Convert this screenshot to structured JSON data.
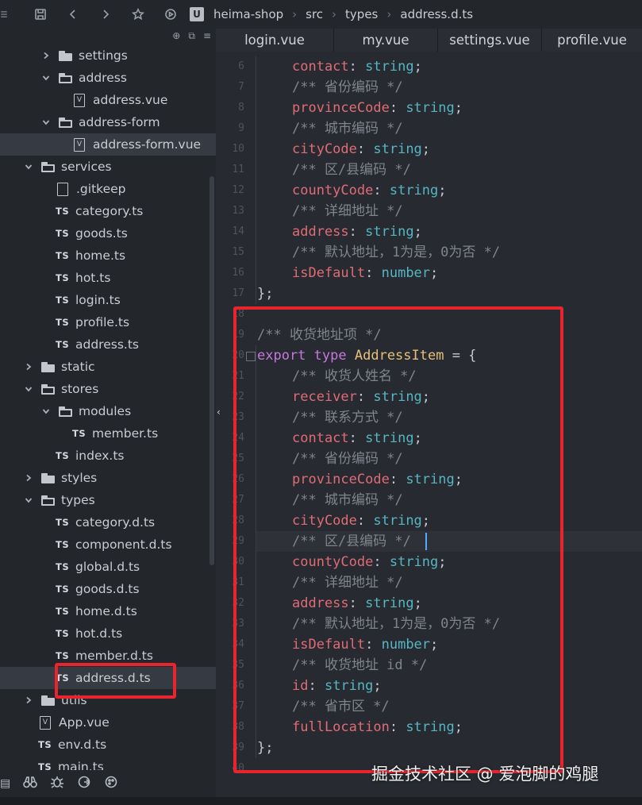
{
  "breadcrumb": [
    "heima-shop",
    "src",
    "types",
    "address.d.ts"
  ],
  "toolbar_icons": [
    "save-icon",
    "back-icon",
    "forward-icon",
    "star-icon",
    "run-icon"
  ],
  "tabs": [
    "login.vue",
    "my.vue",
    "settings.vue",
    "profile.vue"
  ],
  "tree": [
    {
      "label": "settings",
      "kind": "folder",
      "open": false,
      "depth": 2
    },
    {
      "label": "address",
      "kind": "folder",
      "open": true,
      "depth": 2
    },
    {
      "label": "address.vue",
      "kind": "vue",
      "depth": 3
    },
    {
      "label": "address-form",
      "kind": "folder",
      "open": true,
      "depth": 2
    },
    {
      "label": "address-form.vue",
      "kind": "vue",
      "depth": 3,
      "selected": true
    },
    {
      "label": "services",
      "kind": "folder",
      "open": true,
      "depth": 1
    },
    {
      "label": ".gitkeep",
      "kind": "file",
      "depth": 2
    },
    {
      "label": "category.ts",
      "kind": "ts",
      "depth": 2
    },
    {
      "label": "goods.ts",
      "kind": "ts",
      "depth": 2
    },
    {
      "label": "home.ts",
      "kind": "ts",
      "depth": 2
    },
    {
      "label": "hot.ts",
      "kind": "ts",
      "depth": 2
    },
    {
      "label": "login.ts",
      "kind": "ts",
      "depth": 2
    },
    {
      "label": "profile.ts",
      "kind": "ts",
      "depth": 2
    },
    {
      "label": "address.ts",
      "kind": "ts",
      "depth": 2
    },
    {
      "label": "static",
      "kind": "folder",
      "open": false,
      "depth": 1
    },
    {
      "label": "stores",
      "kind": "folder",
      "open": true,
      "depth": 1
    },
    {
      "label": "modules",
      "kind": "folder",
      "open": true,
      "depth": 2
    },
    {
      "label": "member.ts",
      "kind": "ts",
      "depth": 3
    },
    {
      "label": "index.ts",
      "kind": "ts",
      "depth": 2
    },
    {
      "label": "styles",
      "kind": "folder",
      "open": false,
      "depth": 1
    },
    {
      "label": "types",
      "kind": "folder",
      "open": true,
      "depth": 1
    },
    {
      "label": "category.d.ts",
      "kind": "ts",
      "depth": 2
    },
    {
      "label": "component.d.ts",
      "kind": "ts",
      "depth": 2
    },
    {
      "label": "global.d.ts",
      "kind": "ts",
      "depth": 2
    },
    {
      "label": "goods.d.ts",
      "kind": "ts",
      "depth": 2
    },
    {
      "label": "home.d.ts",
      "kind": "ts",
      "depth": 2
    },
    {
      "label": "hot.d.ts",
      "kind": "ts",
      "depth": 2
    },
    {
      "label": "member.d.ts",
      "kind": "ts",
      "depth": 2
    },
    {
      "label": "address.d.ts",
      "kind": "ts",
      "depth": 2,
      "selected": true
    },
    {
      "label": "utils",
      "kind": "folder",
      "open": false,
      "depth": 1
    },
    {
      "label": "App.vue",
      "kind": "vue",
      "depth": 1
    },
    {
      "label": "env.d.ts",
      "kind": "ts",
      "depth": 1
    },
    {
      "label": "main.ts",
      "kind": "ts",
      "depth": 1
    }
  ],
  "code": [
    {
      "n": "6",
      "tokens": [
        [
          "prop",
          "contact"
        ],
        [
          "punc",
          ": "
        ],
        [
          "type",
          "string"
        ],
        [
          "punc",
          ";"
        ]
      ],
      "indent": 2
    },
    {
      "n": "7",
      "tokens": [
        [
          "comment",
          "/** 省份编码 */"
        ]
      ],
      "indent": 2
    },
    {
      "n": "8",
      "tokens": [
        [
          "prop",
          "provinceCode"
        ],
        [
          "punc",
          ": "
        ],
        [
          "type",
          "string"
        ],
        [
          "punc",
          ";"
        ]
      ],
      "indent": 2
    },
    {
      "n": "9",
      "tokens": [
        [
          "comment",
          "/** 城市编码 */"
        ]
      ],
      "indent": 2
    },
    {
      "n": "10",
      "tokens": [
        [
          "prop",
          "cityCode"
        ],
        [
          "punc",
          ": "
        ],
        [
          "type",
          "string"
        ],
        [
          "punc",
          ";"
        ]
      ],
      "indent": 2
    },
    {
      "n": "11",
      "tokens": [
        [
          "comment",
          "/** 区/县编码 */"
        ]
      ],
      "indent": 2
    },
    {
      "n": "12",
      "tokens": [
        [
          "prop",
          "countyCode"
        ],
        [
          "punc",
          ": "
        ],
        [
          "type",
          "string"
        ],
        [
          "punc",
          ";"
        ]
      ],
      "indent": 2
    },
    {
      "n": "13",
      "tokens": [
        [
          "comment",
          "/** 详细地址 */"
        ]
      ],
      "indent": 2
    },
    {
      "n": "14",
      "tokens": [
        [
          "prop",
          "address"
        ],
        [
          "punc",
          ": "
        ],
        [
          "type",
          "string"
        ],
        [
          "punc",
          ";"
        ]
      ],
      "indent": 2
    },
    {
      "n": "15",
      "tokens": [
        [
          "comment",
          "/** 默认地址，1为是，0为否 */"
        ]
      ],
      "indent": 2
    },
    {
      "n": "16",
      "tokens": [
        [
          "prop",
          "isDefault"
        ],
        [
          "punc",
          ": "
        ],
        [
          "type",
          "number"
        ],
        [
          "punc",
          ";"
        ]
      ],
      "indent": 2
    },
    {
      "n": "17",
      "tokens": [
        [
          "punc",
          "};"
        ]
      ],
      "indent": 0
    },
    {
      "n": "18",
      "tokens": [],
      "indent": 0
    },
    {
      "n": "19",
      "tokens": [
        [
          "comment",
          "/** 收货地址项 */"
        ]
      ],
      "indent": 0
    },
    {
      "n": "20",
      "tokens": [
        [
          "kw",
          "export"
        ],
        [
          "punc",
          " "
        ],
        [
          "kw",
          "type"
        ],
        [
          "punc",
          " "
        ],
        [
          "name",
          "AddressItem"
        ],
        [
          "punc",
          " = {"
        ]
      ],
      "indent": 0
    },
    {
      "n": "21",
      "tokens": [
        [
          "comment",
          "/** 收货人姓名 */"
        ]
      ],
      "indent": 2
    },
    {
      "n": "22",
      "tokens": [
        [
          "prop",
          "receiver"
        ],
        [
          "punc",
          ": "
        ],
        [
          "type",
          "string"
        ],
        [
          "punc",
          ";"
        ]
      ],
      "indent": 2
    },
    {
      "n": "23",
      "tokens": [
        [
          "comment",
          "/** 联系方式 */"
        ]
      ],
      "indent": 2
    },
    {
      "n": "24",
      "tokens": [
        [
          "prop",
          "contact"
        ],
        [
          "punc",
          ": "
        ],
        [
          "type",
          "string"
        ],
        [
          "punc",
          ";"
        ]
      ],
      "indent": 2
    },
    {
      "n": "25",
      "tokens": [
        [
          "comment",
          "/** 省份编码 */"
        ]
      ],
      "indent": 2
    },
    {
      "n": "26",
      "tokens": [
        [
          "prop",
          "provinceCode"
        ],
        [
          "punc",
          ": "
        ],
        [
          "type",
          "string"
        ],
        [
          "punc",
          ";"
        ]
      ],
      "indent": 2
    },
    {
      "n": "27",
      "tokens": [
        [
          "comment",
          "/** 城市编码 */"
        ]
      ],
      "indent": 2
    },
    {
      "n": "28",
      "tokens": [
        [
          "prop",
          "cityCode"
        ],
        [
          "punc",
          ": "
        ],
        [
          "type",
          "string"
        ],
        [
          "punc",
          ";"
        ]
      ],
      "indent": 2
    },
    {
      "n": "29",
      "tokens": [
        [
          "comment",
          "/** 区/县编码 */"
        ]
      ],
      "indent": 2,
      "cursor": true
    },
    {
      "n": "30",
      "tokens": [
        [
          "prop",
          "countyCode"
        ],
        [
          "punc",
          ": "
        ],
        [
          "type",
          "string"
        ],
        [
          "punc",
          ";"
        ]
      ],
      "indent": 2
    },
    {
      "n": "31",
      "tokens": [
        [
          "comment",
          "/** 详细地址 */"
        ]
      ],
      "indent": 2
    },
    {
      "n": "32",
      "tokens": [
        [
          "prop",
          "address"
        ],
        [
          "punc",
          ": "
        ],
        [
          "type",
          "string"
        ],
        [
          "punc",
          ";"
        ]
      ],
      "indent": 2
    },
    {
      "n": "33",
      "tokens": [
        [
          "comment",
          "/** 默认地址，1为是，0为否 */"
        ]
      ],
      "indent": 2
    },
    {
      "n": "34",
      "tokens": [
        [
          "prop",
          "isDefault"
        ],
        [
          "punc",
          ": "
        ],
        [
          "type",
          "number"
        ],
        [
          "punc",
          ";"
        ]
      ],
      "indent": 2
    },
    {
      "n": "35",
      "tokens": [
        [
          "comment",
          "/** 收货地址 id */"
        ]
      ],
      "indent": 2
    },
    {
      "n": "36",
      "tokens": [
        [
          "prop",
          "id"
        ],
        [
          "punc",
          ": "
        ],
        [
          "type",
          "string"
        ],
        [
          "punc",
          ";"
        ]
      ],
      "indent": 2
    },
    {
      "n": "37",
      "tokens": [
        [
          "comment",
          "/** 省市区 */"
        ]
      ],
      "indent": 2
    },
    {
      "n": "38",
      "tokens": [
        [
          "prop",
          "fullLocation"
        ],
        [
          "punc",
          ": "
        ],
        [
          "type",
          "string"
        ],
        [
          "punc",
          ";"
        ]
      ],
      "indent": 2
    },
    {
      "n": "39",
      "tokens": [
        [
          "punc",
          "};"
        ]
      ],
      "indent": 0
    },
    {
      "n": "40",
      "tokens": [],
      "indent": 0
    }
  ],
  "watermark": "掘金技术社区 @ 爱泡脚的鸡腿",
  "colors": {
    "highlight": "#e8242e",
    "keyword": "#c678dd",
    "property": "#e06c75",
    "type": "#56b6c2",
    "typename": "#e5c07b",
    "comment": "#7f848e"
  }
}
